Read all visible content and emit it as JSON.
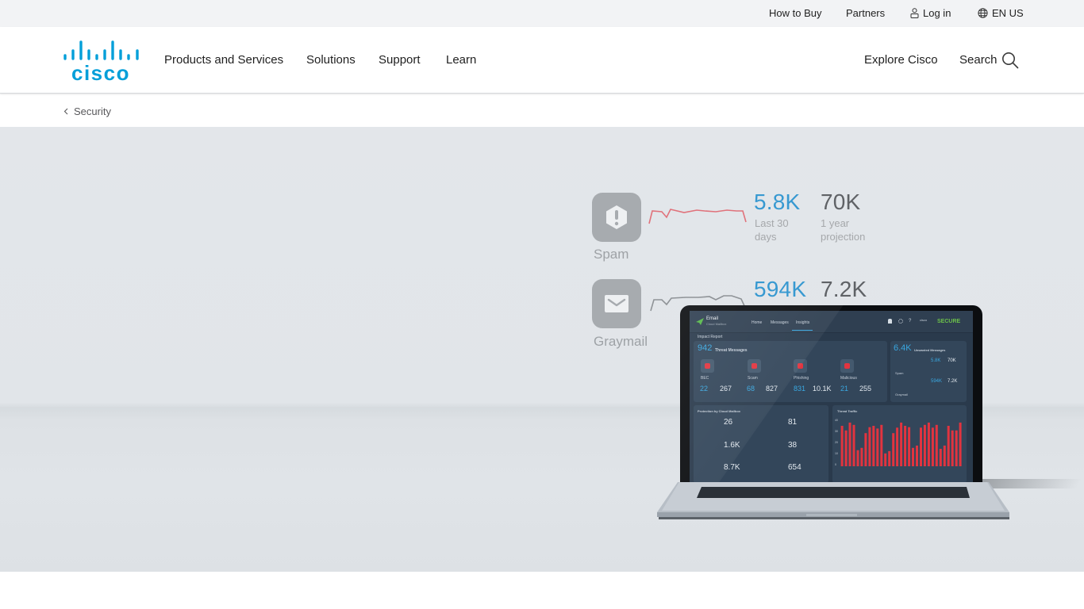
{
  "utility_bar": {
    "how_to_buy": "How to Buy",
    "partners": "Partners",
    "log_in": "Log in",
    "language": "EN US"
  },
  "brand": {
    "logo_text": "cisco",
    "color": "#049fd9"
  },
  "main_nav": {
    "items": [
      {
        "label": "Products and Services"
      },
      {
        "label": "Solutions"
      },
      {
        "label": "Support"
      },
      {
        "label": "Learn"
      }
    ],
    "explore": "Explore Cisco",
    "search": "Search"
  },
  "breadcrumb": {
    "back_label": "Security"
  },
  "hero": {
    "stats": [
      {
        "name": "Spam",
        "last_30_days": "5.8K",
        "last_30_caption": "Last 30 days",
        "projection": "70K",
        "projection_caption": "1 year projection",
        "icon": "exclamation-hexagon-icon"
      },
      {
        "name": "Graymail",
        "last_30_days": "594K",
        "projection": "7.2K",
        "icon": "envelope-icon"
      }
    ],
    "dashboard": {
      "app_title": "Email",
      "app_subtitle": "Cloud Mailbox",
      "tabs": [
        "Home",
        "Messages",
        "Insights"
      ],
      "active_tab": "Insights",
      "brand_secure": "SECURE",
      "section_title": "Impact Report",
      "threat_total": "942",
      "threat_total_label": "Threat Messages",
      "unwanted_total": "6.4K",
      "unwanted_total_label": "Unwanted Messages",
      "categories": [
        {
          "name": "BEC",
          "last_30": "22",
          "projection": "267"
        },
        {
          "name": "Scam",
          "last_30": "68",
          "projection": "827"
        },
        {
          "name": "Phishing",
          "last_30": "831",
          "projection": "10.1K"
        },
        {
          "name": "Malicious",
          "last_30": "21",
          "projection": "255"
        }
      ],
      "unwanted": [
        {
          "name": "Spam",
          "last_30": "5.8K",
          "projection": "70K"
        },
        {
          "name": "Graymail",
          "last_30": "594K",
          "projection": "7.2K"
        }
      ],
      "protection_title": "Protection by Cloud Mailbox",
      "protection": [
        "26",
        "81",
        "1.6K",
        "38",
        "8.7K",
        "654"
      ],
      "traffic_title": "Threat Traffic",
      "traffic_y_ticks": [
        "40",
        "30",
        "20",
        "10",
        "0"
      ]
    }
  }
}
